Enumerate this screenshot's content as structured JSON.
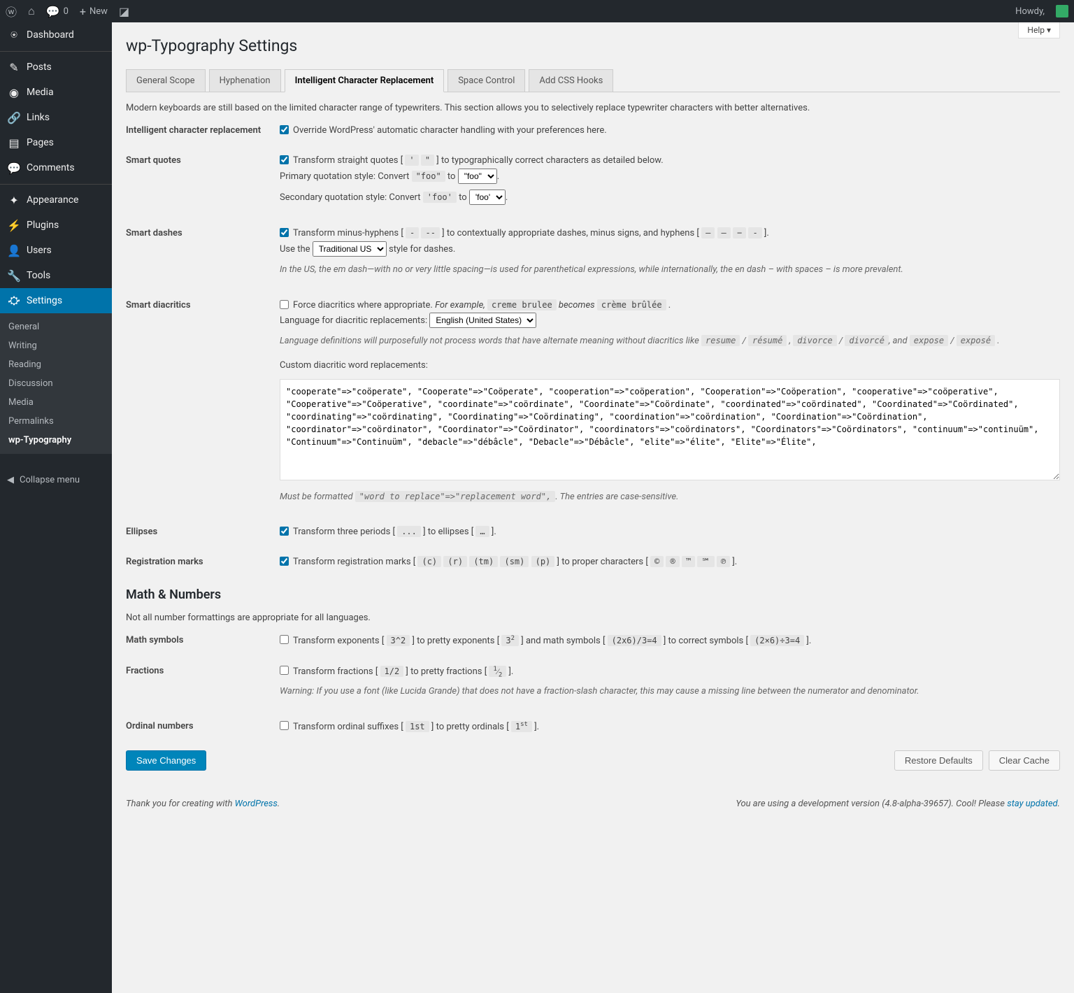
{
  "topbar": {
    "comments": "0",
    "new": "New",
    "howdy": "Howdy,"
  },
  "sidebar": {
    "items": [
      {
        "icon": "⍟",
        "label": "Dashboard"
      },
      {
        "icon": "✎",
        "label": "Posts"
      },
      {
        "icon": "◉",
        "label": "Media"
      },
      {
        "icon": "🔗",
        "label": "Links"
      },
      {
        "icon": "▤",
        "label": "Pages"
      },
      {
        "icon": "💬",
        "label": "Comments"
      },
      {
        "icon": "✦",
        "label": "Appearance"
      },
      {
        "icon": "⚡",
        "label": "Plugins"
      },
      {
        "icon": "👤",
        "label": "Users"
      },
      {
        "icon": "🔧",
        "label": "Tools"
      },
      {
        "icon": "⛮",
        "label": "Settings"
      }
    ],
    "submenu": [
      "General",
      "Writing",
      "Reading",
      "Discussion",
      "Media",
      "Permalinks",
      "wp-Typography"
    ],
    "collapse": "Collapse menu"
  },
  "help": "Help ▾",
  "page_title": "wp-Typography Settings",
  "tabs": [
    "General Scope",
    "Hyphenation",
    "Intelligent Character Replacement",
    "Space Control",
    "Add CSS Hooks"
  ],
  "intro": "Modern keyboards are still based on the limited character range of typewriters. This section allows you to selectively replace typewriter characters with better alternatives.",
  "rows": {
    "icr": {
      "label": "Intelligent character replacement",
      "text": "Override WordPress' automatic character handling with your preferences here."
    },
    "quotes": {
      "label": "Smart quotes",
      "text1a": "Transform straight quotes [ ",
      "q1": "'",
      "q2": "\"",
      "text1b": " ] to typographically correct characters as detailed below.",
      "primary": "Primary quotation style: Convert ",
      "pq": "\"foo\"",
      "to": " to ",
      "period": ".",
      "secondary": "Secondary quotation style: Convert ",
      "sq": "'foo'",
      "opt1": "\"foo\"",
      "opt2": "'foo'"
    },
    "dashes": {
      "label": "Smart dashes",
      "text1a": "Transform minus-hyphens [ ",
      "d1": "-",
      "d2": "--",
      "text1b": " ] to contextually appropriate dashes, minus signs, and hyphens [ ",
      "d3": "–",
      "d4": "—",
      "d5": "−",
      "d6": "‐",
      "text1c": " ].",
      "use": "Use the ",
      "style_opt": "Traditional US",
      "style_text": " style for dashes.",
      "note": "In the US, the em dash—with no or very little spacing—is used for parenthetical expressions, while internationally, the en dash – with spaces – is more prevalent."
    },
    "diacritics": {
      "label": "Smart diacritics",
      "force": "Force diacritics where appropriate. ",
      "eg": "For example, ",
      "ex1": "creme brulee",
      "becomes": " becomes ",
      "ex2": "crème brûlée",
      "lang_label": "Language for diacritic replacements: ",
      "lang_opt": "English (United States)",
      "note1": "Language definitions will purposefully not process words that have alternate meaning without diacritics like ",
      "r1": "resume",
      "r2": "résumé",
      "d1": "divorce",
      "d2": "divorcé",
      "and": ", and ",
      "e1": "expose",
      "e2": "exposé",
      "slash": " / ",
      "custom_label": "Custom diacritic word replacements:",
      "custom_val": "\"cooperate\"=>\"coöperate\", \"Cooperate\"=>\"Coöperate\", \"cooperation\"=>\"coöperation\", \"Cooperation\"=>\"Coöperation\", \"cooperative\"=>\"coöperative\", \"Cooperative\"=>\"Coöperative\", \"coordinate\"=>\"coördinate\", \"Coordinate\"=>\"Coördinate\", \"coordinated\"=>\"coördinated\", \"Coordinated\"=>\"Coördinated\", \"coordinating\"=>\"coördinating\", \"Coordinating\"=>\"Coördinating\", \"coordination\"=>\"coördination\", \"Coordination\"=>\"Coördination\", \"coordinator\"=>\"coördinator\", \"Coordinator\"=>\"Coördinator\", \"coordinators\"=>\"coördinators\", \"Coordinators\"=>\"Coördinators\", \"continuum\"=>\"continuüm\", \"Continuum\"=>\"Continuüm\", \"debacle\"=>\"débâcle\", \"Debacle\"=>\"Débâcle\", \"elite\"=>\"élite\", \"Elite\"=>\"Élite\",",
      "must": "Must be formatted ",
      "fmt": "\"word to replace\"=>\"replacement word\",",
      "entries": ". The entries are case-sensitive."
    },
    "ellipses": {
      "label": "Ellipses",
      "t1": "Transform three periods [ ",
      "c1": "...",
      "t2": " ] to ellipses [ ",
      "c2": "…",
      "t3": " ]."
    },
    "marks": {
      "label": "Registration marks",
      "t1": "Transform registration marks [ ",
      "c": "(c)",
      "r": "(r)",
      "tm": "(tm)",
      "sm": "(sm)",
      "p": "(p)",
      "t2": " ] to proper characters [ ",
      "cc": "©",
      "rr": "®",
      "ttm": "™",
      "ssm": "℠",
      "pp": "℗",
      "t3": " ]."
    },
    "math_heading": "Math & Numbers",
    "math_intro": "Not all number formattings are appropriate for all languages.",
    "math": {
      "label": "Math symbols",
      "t1": "Transform exponents [ ",
      "e1": "3^2",
      "t2": " ] to pretty exponents [ ",
      "e2a": "3",
      "e2b": "2",
      "t3": " ] and math symbols [ ",
      "m1": "(2x6)/3=4",
      "t4": " ] to correct symbols [ ",
      "m2": "(2×6)÷3=4",
      "t5": " ]."
    },
    "fractions": {
      "label": "Fractions",
      "t1": "Transform fractions [ ",
      "f1": "1/2",
      "t2": " ] to pretty fractions [ ",
      "f2a": "1",
      "f2b": "2",
      "t3": " ].",
      "warn": "Warning: If you use a font (like Lucida Grande) that does not have a fraction-slash character, this may cause a missing line between the numerator and denominator."
    },
    "ordinal": {
      "label": "Ordinal numbers",
      "t1": "Transform ordinal suffixes [ ",
      "o1": "1st",
      "t2": " ] to pretty ordinals [ ",
      "o2a": "1",
      "o2b": "st",
      "t3": " ]."
    }
  },
  "buttons": {
    "save": "Save Changes",
    "restore": "Restore Defaults",
    "clear": "Clear Cache"
  },
  "footer": {
    "thank": "Thank you for creating with ",
    "wp": "WordPress",
    "dev": "You are using a development version (4.8-alpha-39657). Cool! Please ",
    "stay": "stay updated"
  }
}
